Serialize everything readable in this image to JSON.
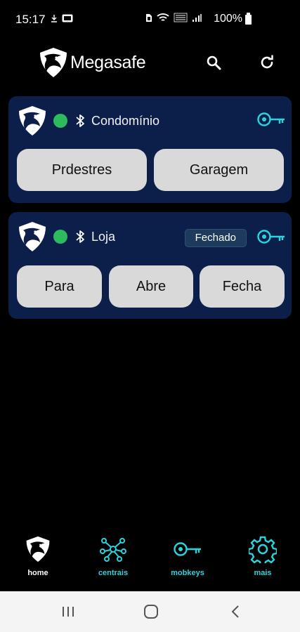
{
  "status_bar": {
    "time": "15:17",
    "battery": "100%"
  },
  "header": {
    "app_name": "Megasafe",
    "icons": [
      "eagle-logo-icon",
      "search-icon",
      "refresh-icon"
    ]
  },
  "cards": [
    {
      "name": "Condomínio",
      "online": true,
      "bluetooth": true,
      "status_chip": "",
      "buttons": [
        "Prdestres",
        "Garagem"
      ]
    },
    {
      "name": "Loja",
      "online": true,
      "bluetooth": true,
      "status_chip": "Fechado",
      "buttons": [
        "Para",
        "Abre",
        "Fecha"
      ]
    }
  ],
  "bottom_nav": [
    {
      "label": "home",
      "icon": "eagle-icon",
      "active": true
    },
    {
      "label": "centrais",
      "icon": "network-icon",
      "active": false
    },
    {
      "label": "mobkeys",
      "icon": "key-icon",
      "active": false
    },
    {
      "label": "mais",
      "icon": "gear-icon",
      "active": false
    }
  ],
  "colors": {
    "background": "#000000",
    "card": "#0b1f4a",
    "online_dot": "#2dbb5d",
    "accent_teal": "#2ad4dc",
    "button_bg": "#d9d9d9"
  }
}
